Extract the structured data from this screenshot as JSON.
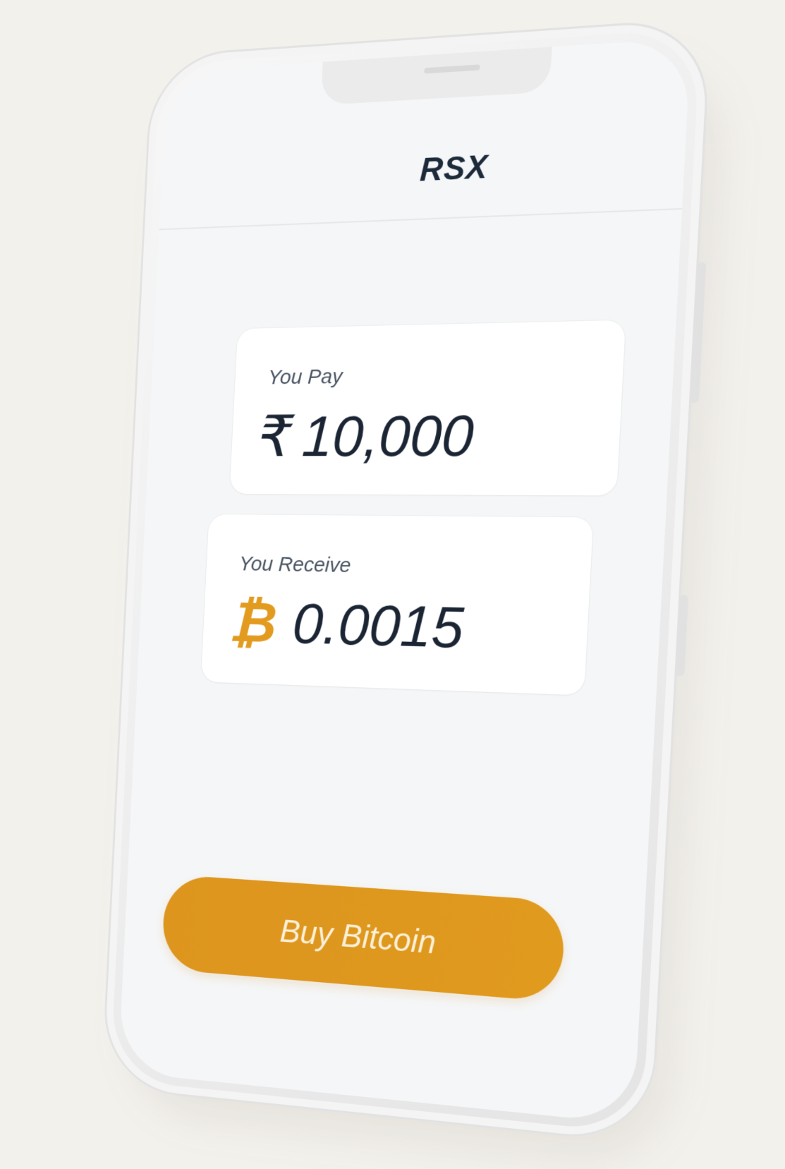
{
  "app": {
    "title": "RSX"
  },
  "exchange": {
    "pay": {
      "label": "You Pay",
      "currency_symbol": "₹",
      "amount": "10,000"
    },
    "receive": {
      "label": "You Receive",
      "currency_symbol": "₿",
      "amount": "0.0015"
    }
  },
  "actions": {
    "buy_label": "Buy Bitcoin"
  },
  "colors": {
    "accent": "#e09a1e",
    "background": "#f3f1ec",
    "text_primary": "#1b2534",
    "bitcoin": "#e39b1f"
  },
  "icons": {
    "pay_currency": "rupee-icon",
    "receive_currency": "bitcoin-icon"
  }
}
